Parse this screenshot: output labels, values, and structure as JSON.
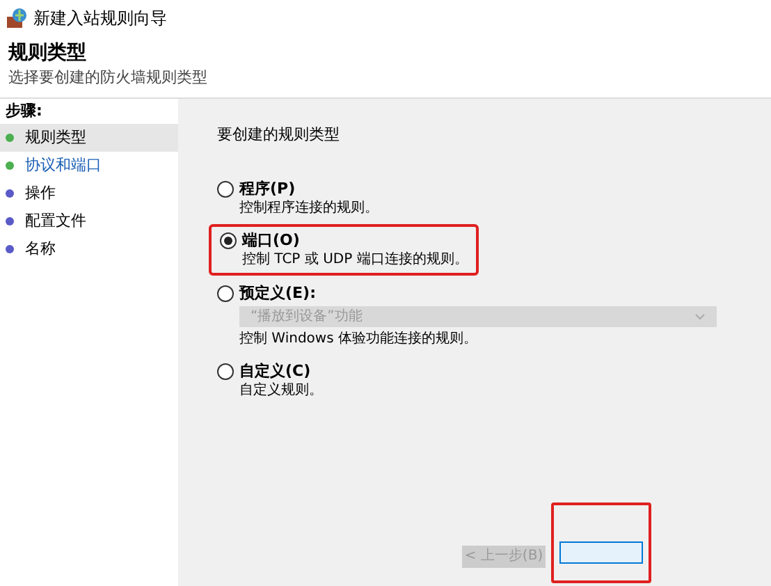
{
  "window": {
    "title": "新建入站规则向导"
  },
  "header": {
    "title": "规则类型",
    "subtitle": "选择要创建的防火墙规则类型"
  },
  "steps": {
    "heading": "步骤:",
    "items": [
      {
        "label": "规则类型",
        "selected": true,
        "done": true
      },
      {
        "label": "协议和端口",
        "selected": false,
        "done": true
      },
      {
        "label": "操作",
        "selected": false,
        "done": false
      },
      {
        "label": "配置文件",
        "selected": false,
        "done": false
      },
      {
        "label": "名称",
        "selected": false,
        "done": false
      }
    ]
  },
  "prompt": "要创建的规则类型",
  "options": [
    {
      "label": "程序(P)",
      "description": "控制程序连接的规则。",
      "selected": false,
      "highlighted": false
    },
    {
      "label": "端口(O)",
      "description": "控制 TCP 或 UDP 端口连接的规则。",
      "selected": true,
      "highlighted": true
    },
    {
      "label": "预定义(E):",
      "dropdown": {
        "value": "“播放到设备”功能",
        "disabled": true
      },
      "description": "控制 Windows 体验功能连接的规则。",
      "selected": false,
      "highlighted": false
    },
    {
      "label": "自定义(C)",
      "description": "自定义规则。",
      "selected": false,
      "highlighted": false
    }
  ],
  "buttons": [
    {
      "label": "< 上一步(B)",
      "disabled": true,
      "highlighted": false
    },
    {
      "disabled": false,
      "highlighted": true
    }
  ]
}
